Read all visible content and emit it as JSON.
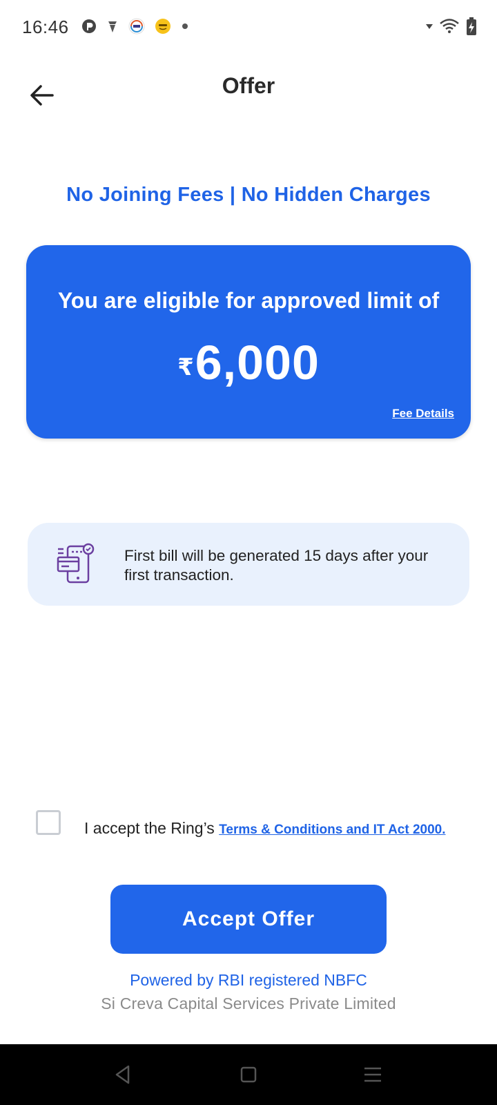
{
  "status_bar": {
    "time": "16:46",
    "icons_left": [
      "p-app-icon",
      "android-notif-icon",
      "sbi-app-icon",
      "emoji-app-icon",
      "dot-icon"
    ],
    "icons_right": [
      "signal-arrow-icon",
      "wifi-icon",
      "battery-charging-icon"
    ]
  },
  "app_bar": {
    "title": "Offer",
    "back_icon": "arrow-left-icon"
  },
  "tagline": "No Joining Fees | No Hidden Charges",
  "limit_card": {
    "heading": "You are eligible for approved limit of",
    "currency_symbol": "₹",
    "amount": "6,000",
    "fee_link": "Fee Details",
    "background": "#2166ea"
  },
  "info_box": {
    "icon": "bill-phone-icon",
    "text": "First bill will be generated 15 days after your first transaction.",
    "background": "#e9f1fd"
  },
  "terms": {
    "checked": false,
    "prefix": "I accept the Ring’s ",
    "link": "Terms & Conditions and IT Act 2000."
  },
  "accept_button": {
    "label": "Accept Offer"
  },
  "footer": {
    "powered_by": "Powered by RBI registered NBFC",
    "company": "Si Creva Capital Services Private Limited"
  },
  "nav_bar": {
    "icons": [
      "back-triangle-icon",
      "home-square-icon",
      "menu-lines-icon"
    ]
  },
  "colors": {
    "accent": "#1f63e6",
    "primary_button": "#2166ea",
    "muted_text": "#8a8a8a"
  }
}
